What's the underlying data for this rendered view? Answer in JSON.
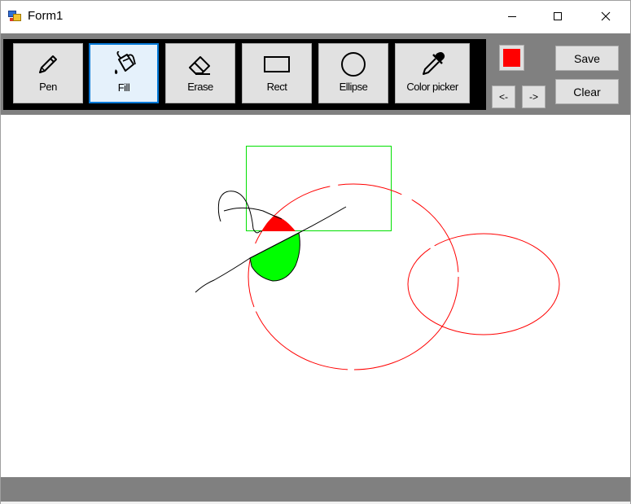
{
  "window": {
    "title": "Form1",
    "app_icon": "winforms-app-icon",
    "controls": [
      "minimize-icon",
      "maximize-icon",
      "close-icon"
    ]
  },
  "toolbar": {
    "tools": [
      {
        "label": "Pen",
        "icon": "pencil-icon",
        "active": false
      },
      {
        "label": "Fill",
        "icon": "paint-bucket-icon",
        "active": true
      },
      {
        "label": "Erase",
        "icon": "eraser-icon",
        "active": false
      },
      {
        "label": "Rect",
        "icon": "rectangle-icon",
        "active": false
      },
      {
        "label": "Ellipse",
        "icon": "ellipse-icon",
        "active": false
      },
      {
        "label": "Color picker",
        "icon": "eyedropper-icon",
        "active": false
      }
    ],
    "current_color": "#ff0000",
    "undo_label": "<-",
    "redo_label": "->",
    "save_label": "Save",
    "clear_label": "Clear"
  },
  "canvas": {
    "background": "#ffffff",
    "shapes": [
      {
        "kind": "rectangle",
        "color": "#00e000"
      },
      {
        "kind": "ellipse",
        "color": "#ff0000",
        "dashed_gaps": true
      },
      {
        "kind": "ellipse",
        "color": "#ff0000"
      },
      {
        "kind": "freehand",
        "color": "#000000"
      },
      {
        "kind": "filled-region",
        "color": "#ff0000"
      },
      {
        "kind": "filled-region",
        "color": "#00ff00"
      }
    ]
  },
  "colors": {
    "toolbar_bg": "#808080",
    "tool_strip_bg": "#000000",
    "button_bg": "#e1e1e1",
    "active_border": "#0078d7",
    "statusbar_bg": "#808080"
  }
}
